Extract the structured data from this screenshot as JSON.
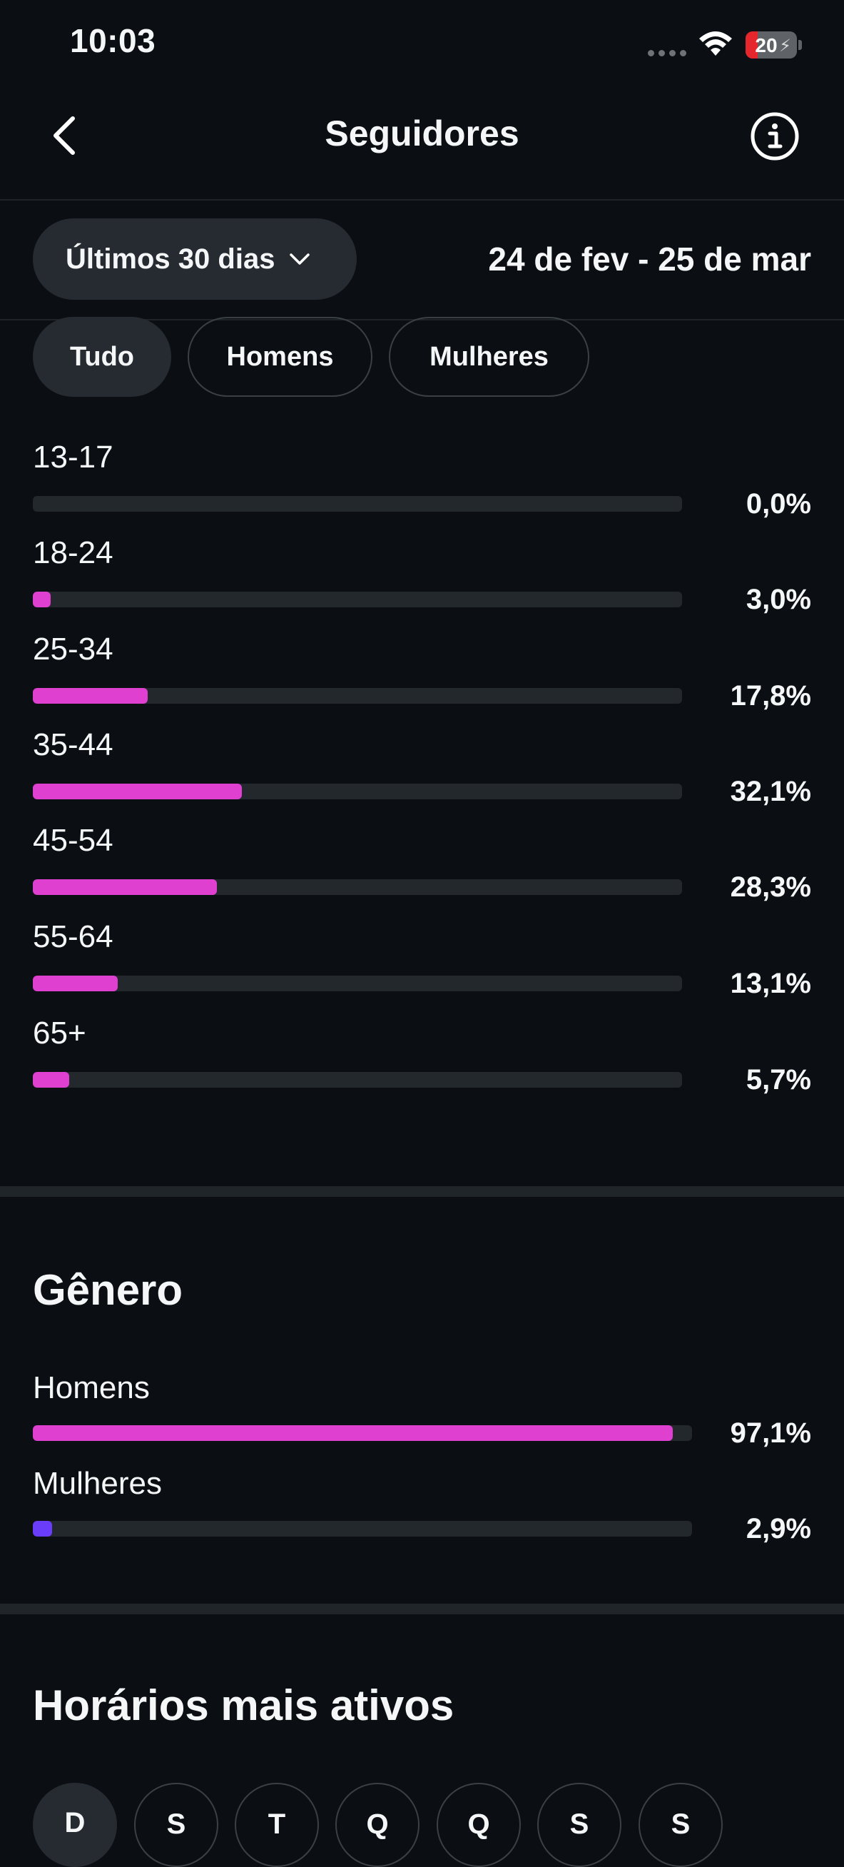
{
  "status": {
    "time": "10:03",
    "battery": "20"
  },
  "nav": {
    "title": "Seguidores"
  },
  "range": {
    "label": "Últimos 30 dias",
    "dates": "24 de fev - 25 de mar"
  },
  "filters": [
    "Tudo",
    "Homens",
    "Mulheres"
  ],
  "accent_colors": {
    "age": "#e040d0",
    "women": "#6a3dfb"
  },
  "age_groups": [
    {
      "label": "13-17",
      "value": "0,0%",
      "fill": 0.0
    },
    {
      "label": "18-24",
      "value": "3,0%",
      "fill": 0.028
    },
    {
      "label": "25-34",
      "value": "17,8%",
      "fill": 0.177
    },
    {
      "label": "35-44",
      "value": "32,1%",
      "fill": 0.322
    },
    {
      "label": "45-54",
      "value": "28,3%",
      "fill": 0.283
    },
    {
      "label": "55-64",
      "value": "13,1%",
      "fill": 0.131
    },
    {
      "label": "65+",
      "value": "5,7%",
      "fill": 0.056
    }
  ],
  "gender": {
    "title": "Gênero",
    "items": [
      {
        "label": "Homens",
        "value": "97,1%",
        "fill": 0.971
      },
      {
        "label": "Mulheres",
        "value": "2,9%",
        "fill": 0.029
      }
    ]
  },
  "active_times": {
    "title": "Horários mais ativos",
    "days": [
      "D",
      "S",
      "T",
      "Q",
      "Q",
      "S",
      "S"
    ]
  }
}
